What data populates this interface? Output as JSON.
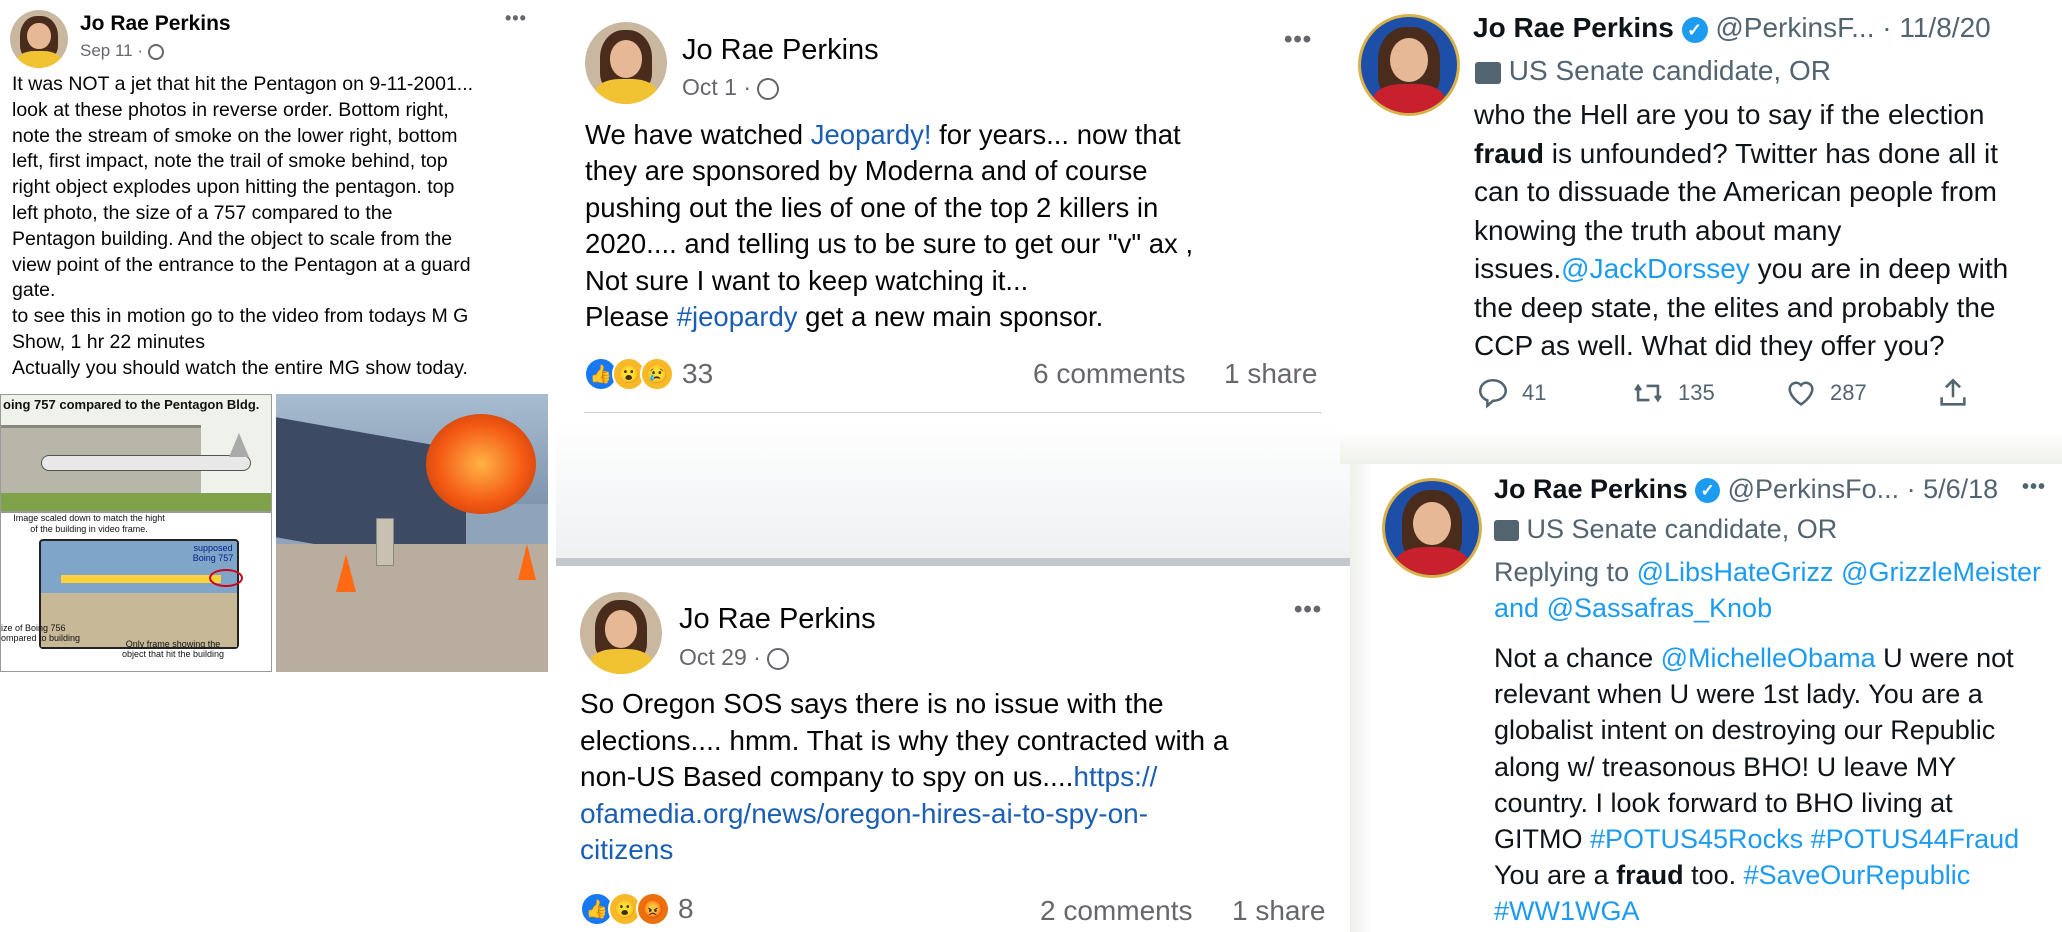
{
  "post1": {
    "author": "Jo Rae Perkins",
    "date": "Sep 11 ·",
    "lines": [
      "It was NOT a jet that hit the Pentagon on 9-11-2001...",
      "look at these photos in reverse order. Bottom right,",
      "note the stream of smoke on the lower right, bottom",
      "left, first impact, note the trail of smoke behind, top",
      "right object explodes upon hitting the pentagon. top",
      "left photo, the size of a 757 compared to the",
      "Pentagon building. And the object to scale from the",
      "view point of the entrance to the Pentagon at a guard",
      "gate.",
      "to see this in motion go to the video from todays M G",
      "Show, 1 hr 22 minutes",
      "Actually you should watch the entire MG show today."
    ],
    "photo_caption_top": "oing 757 compared to the Pentagon Bldg.",
    "photo_caption_scaled": "Image scaled down to match the hight of the building in video frame.",
    "photo_caption_supposed": "supposed Boing 757",
    "photo_caption_size": "ize of Boing 756 ompared to building",
    "photo_caption_frame": "Only frame showing the object that hit the building"
  },
  "post2": {
    "author": "Jo Rae Perkins",
    "date": "Oct 1 ·",
    "text_parts": {
      "a": "We have watched ",
      "link1": "Jeopardy!",
      "b": " for years... now that",
      "line2": "they are sponsored by Moderna and of course",
      "line3": "pushing out the lies of one of the top 2 killers in",
      "line4": "2020.... and telling us to be sure to get our \"v\" ax ,",
      "line5": "Not sure I want to keep watching it...",
      "c": "Please ",
      "hashtag": "#jeopardy",
      "d": " get a new main sponsor."
    },
    "reaction_count": "33",
    "comments": "6 comments",
    "shares": "1 share"
  },
  "post3": {
    "author": "Jo Rae Perkins",
    "date": "Oct 29 ·",
    "lines": [
      "So Oregon SOS says there is no issue with the",
      "elections.... hmm. That is why they contracted with a",
      "non-US Based company to spy on us...."
    ],
    "link_part1": "https://",
    "link_part2": "ofamedia.org/news/oregon-hires-ai-to-spy-on-",
    "link_part3": "citizens",
    "reaction_count": "8",
    "comments": "2 comments",
    "shares": "1 share"
  },
  "tweet1": {
    "name": "Jo Rae Perkins",
    "handle": "@PerkinsF...",
    "date": "· 11/8/20",
    "label": "US Senate candidate, OR",
    "line1": "who the Hell are you to say if the election",
    "bold1": "fraud",
    "line2rest": " is unfounded? Twitter has done all it",
    "line3": "can to dissuade the American people from",
    "line4": "knowing the truth about many",
    "line5a": "issues.",
    "mention": "@JackDorssey",
    "line5b": " you are in deep with",
    "line6": "the deep state, the elites and probably the",
    "line7": "CCP as well. What did they offer you?",
    "replies": "41",
    "retweets": "135",
    "likes": "287"
  },
  "tweet2": {
    "name": "Jo Rae Perkins",
    "handle": "@PerkinsFo...",
    "date": "· 5/6/18",
    "label": "US Senate candidate, OR",
    "replying_to": "Replying to ",
    "mention1": "@LibsHateGrizz",
    "mention2": "@GrizzleMeister",
    "and_text": "and ",
    "mention3": "@Sassafras_Knob",
    "l1a": "Not a chance ",
    "mention4": "@MichelleObama",
    "l1b": " U were not",
    "l2": "relevant when U were 1st lady. You are a",
    "l3": "globalist intent on destroying our Republic",
    "l4": "along w/ treasonous BHO! U leave MY",
    "l5": "country. I look forward to BHO living at",
    "l6a": "GITMO ",
    "hashtag1": "#POTUS45Rocks",
    "hashtag2": "#POTUS44Fraud",
    "l7a": "You are a ",
    "bold": "fraud",
    "l7b": " too. ",
    "hashtag3": "#SaveOurRepublic",
    "hashtag4": "#WW1WGA"
  },
  "icons": {
    "more": "•••",
    "reply": "reply-icon",
    "retweet": "retweet-icon",
    "like": "heart-icon",
    "share": "share-icon"
  },
  "colors": {
    "facebook_link": "#1a5fb4",
    "twitter_link": "#1d9bf0",
    "verified": "#1d9bf0",
    "fire": "#f45a14"
  }
}
